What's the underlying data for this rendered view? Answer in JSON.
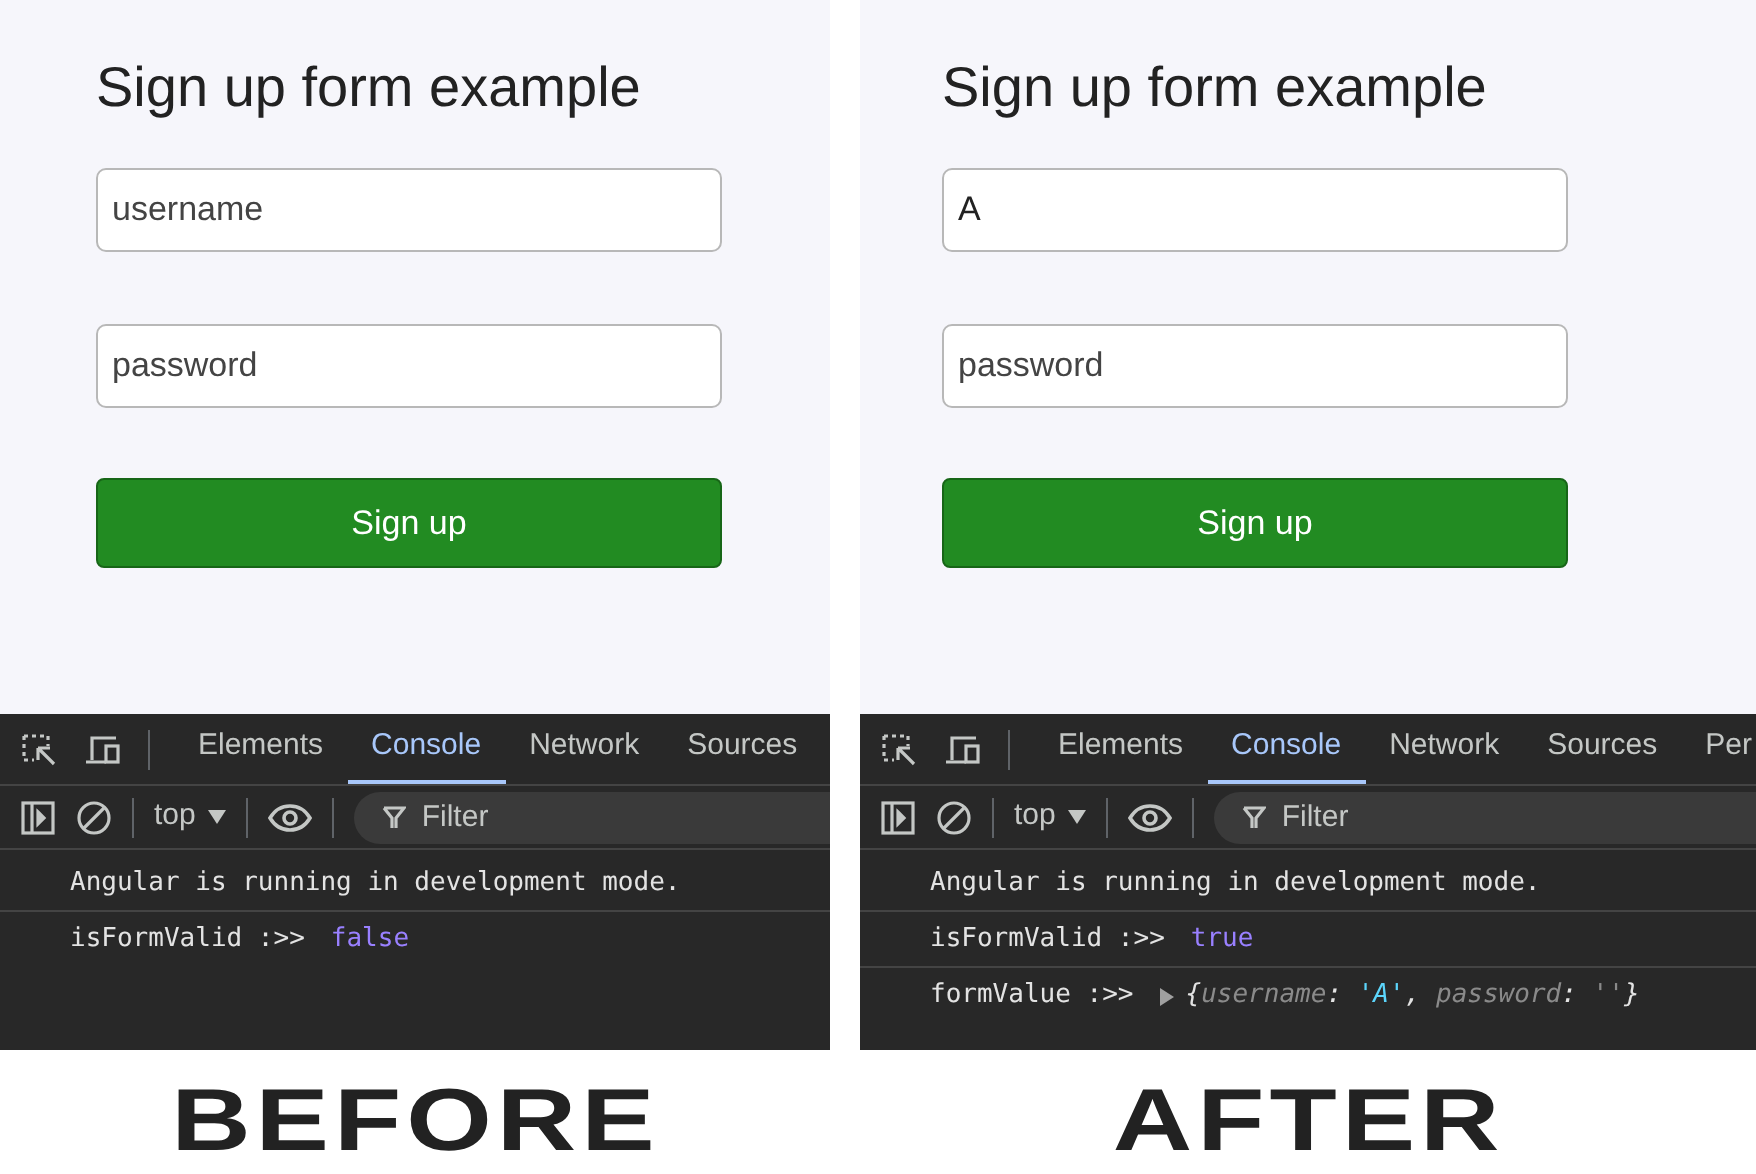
{
  "panels": [
    {
      "caption": "BEFORE",
      "form": {
        "title": "Sign up form example",
        "fields": [
          {
            "kind": "text",
            "placeholder": "username"
          },
          {
            "kind": "password",
            "placeholder": "password"
          }
        ],
        "button": "Sign up"
      },
      "devtools": {
        "tabs": [
          {
            "label": "Elements",
            "selected": false
          },
          {
            "label": "Console",
            "selected": true
          },
          {
            "label": "Network",
            "selected": false
          },
          {
            "label": "Sources",
            "selected": false
          }
        ],
        "context": "top",
        "filter": {
          "placeholder": "Filter"
        },
        "logs": [
          {
            "kind": "text",
            "text": "Angular is running in development mode."
          },
          {
            "kind": "value",
            "label": "isFormValid :>>",
            "value": "false"
          }
        ]
      }
    },
    {
      "caption": "AFTER",
      "form": {
        "title": "Sign up form example",
        "fields": [
          {
            "kind": "text",
            "value": "A"
          },
          {
            "kind": "password",
            "placeholder": "password"
          }
        ],
        "button": "Sign up"
      },
      "devtools": {
        "tabs": [
          {
            "label": "Elements",
            "selected": false
          },
          {
            "label": "Console",
            "selected": true
          },
          {
            "label": "Network",
            "selected": false
          },
          {
            "label": "Sources",
            "selected": false
          },
          {
            "label": "Per",
            "selected": false
          }
        ],
        "context": "top",
        "filter": {
          "placeholder": "Filter"
        },
        "logs": [
          {
            "kind": "text",
            "text": "Angular is running in development mode."
          },
          {
            "kind": "value",
            "label": "isFormValid :>>",
            "value": "true"
          },
          {
            "kind": "object",
            "label": "formValue :>>",
            "tokens": [
              {
                "kind": "punct",
                "text": "{"
              },
              {
                "kind": "key",
                "text": "username"
              },
              {
                "kind": "punct",
                "text": ":"
              },
              {
                "kind": "string",
                "text": "'A'"
              },
              {
                "kind": "punct",
                "text": ","
              },
              {
                "kind": "key",
                "text": "password"
              },
              {
                "kind": "punct",
                "text": ":"
              },
              {
                "kind": "empty",
                "text": "''"
              },
              {
                "kind": "punct",
                "text": "}"
              }
            ]
          }
        ]
      }
    }
  ]
}
